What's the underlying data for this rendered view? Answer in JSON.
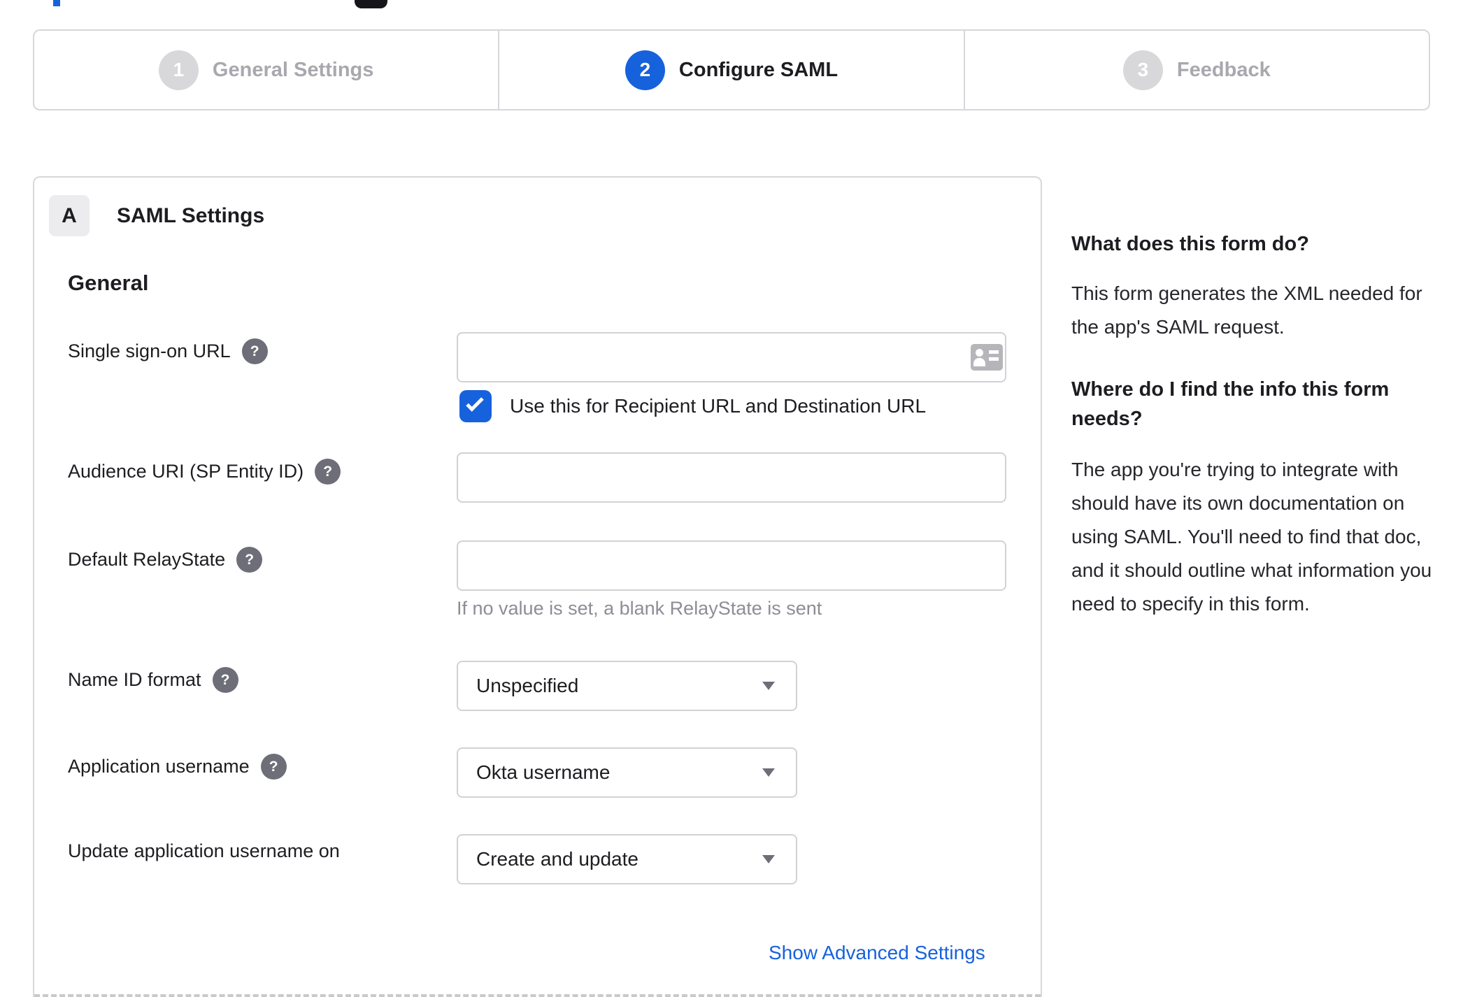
{
  "colors": {
    "accent_blue": "#1662dd",
    "border_gray": "#d7d7dc",
    "inactive_gray": "#a8a8ae",
    "helper_gray": "#8d8d95",
    "text_dark": "#1d1d21"
  },
  "icons": {
    "help_glyph": "?"
  },
  "stepper": {
    "steps": [
      {
        "number": "1",
        "label": "General Settings",
        "state": "inactive"
      },
      {
        "number": "2",
        "label": "Configure SAML",
        "state": "active"
      },
      {
        "number": "3",
        "label": "Feedback",
        "state": "inactive"
      }
    ]
  },
  "panel": {
    "section_badge": "A",
    "section_title": "SAML Settings",
    "group_title": "General",
    "fields": [
      {
        "label": "Single sign-on URL",
        "type": "text",
        "value": "",
        "has_help": true,
        "checkbox": {
          "checked": true,
          "label": "Use this for Recipient URL and Destination URL"
        }
      },
      {
        "label": "Audience URI (SP Entity ID)",
        "type": "text",
        "value": "",
        "has_help": true
      },
      {
        "label": "Default RelayState",
        "type": "text",
        "value": "",
        "has_help": true,
        "helper": "If no value is set, a blank RelayState is sent"
      },
      {
        "label": "Name ID format",
        "type": "select",
        "value": "Unspecified",
        "has_help": true
      },
      {
        "label": "Application username",
        "type": "select",
        "value": "Okta username",
        "has_help": true
      },
      {
        "label": "Update application username on",
        "type": "select",
        "value": "Create and update",
        "has_help": false
      }
    ],
    "advanced_link": "Show Advanced Settings"
  },
  "sidebar": {
    "sections": [
      {
        "heading": "What does this form do?",
        "body": "This form generates the XML needed for the app's SAML request."
      },
      {
        "heading": "Where do I find the info this form needs?",
        "body": "The app you're trying to integrate with should have its own documentation on using SAML. You'll need to find that doc, and it should outline what information you need to specify in this form."
      }
    ]
  }
}
